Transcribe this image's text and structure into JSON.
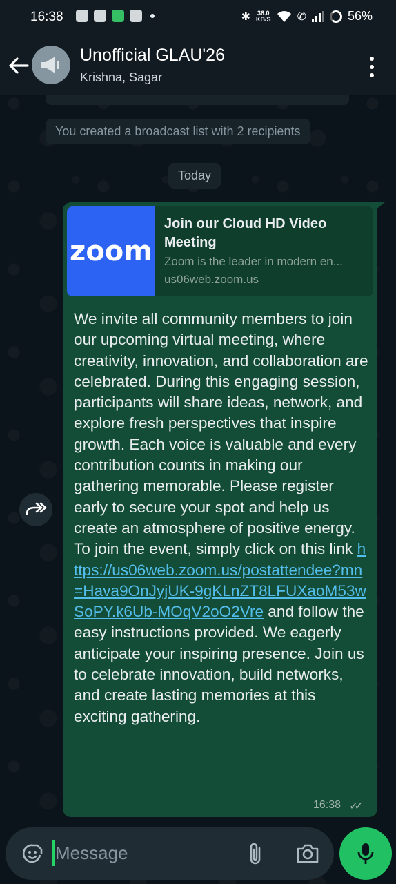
{
  "status_bar": {
    "time": "16:38",
    "network_speed_value": "36.0",
    "network_speed_unit": "KB/S",
    "battery": "56%"
  },
  "header": {
    "title": "Unofficial GLAU'26",
    "subtitle": "Krishna, Sagar"
  },
  "system_messages": {
    "broadcast_created": "You created a broadcast list with 2 recipients",
    "date_divider": "Today"
  },
  "message": {
    "preview": {
      "thumb_word": "zoom",
      "title": "Join our Cloud HD Video Meeting",
      "description": "Zoom is the leader in modern en...",
      "domain": "us06web.zoom.us"
    },
    "text_before_link": "We invite all community members to join our upcoming virtual meeting, where creativity, innovation, and collaboration are celebrated. During this engaging session, participants will share ideas, network, and explore fresh perspectives that inspire growth. Each voice is valuable and every contribution counts in making our gathering memorable. Please register early to secure your spot and help us create an atmosphere of positive energy. To join the event, simply click on this link ",
    "link": "https://us06web.zoom.us/postattendee?mn=Hava9OnJyjUK-9gKLnZT8LFUXaoM53wSoPY.k6Ub-MOqV2oO2Vre",
    "text_after_link": " and follow the easy instructions provided. We eagerly anticipate your inspiring presence. Join us to celebrate innovation, build networks, and create lasting memories at this exciting gathering.",
    "time": "16:38",
    "status": "read"
  },
  "input": {
    "placeholder": "Message"
  },
  "colors": {
    "background": "#0b141a",
    "header": "#121b22",
    "outgoing_bubble": "#144d37",
    "link": "#53bdeb",
    "accent": "#21c063",
    "zoom_blue": "#2d63f2"
  },
  "icons": [
    "back-arrow-icon",
    "megaphone-icon",
    "more-vert-icon",
    "forward-icon",
    "emoji-sticker-icon",
    "attach-clip-icon",
    "camera-icon",
    "mic-icon",
    "double-check-icon"
  ]
}
